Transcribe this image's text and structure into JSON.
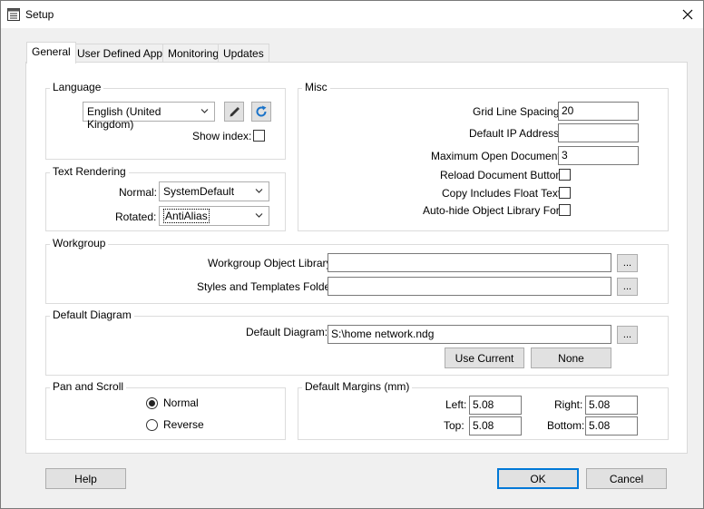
{
  "window": {
    "title": "Setup"
  },
  "tabs": [
    {
      "label": "General"
    },
    {
      "label": "User Defined Apps"
    },
    {
      "label": "Monitoring"
    },
    {
      "label": "Updates"
    }
  ],
  "language": {
    "group_title": "Language",
    "selected": "English (United Kingdom)",
    "show_index_label": "Show index:"
  },
  "text_rendering": {
    "group_title": "Text Rendering",
    "normal_label": "Normal:",
    "normal_value": "SystemDefault",
    "rotated_label": "Rotated:",
    "rotated_value": "AntiAlias"
  },
  "misc": {
    "group_title": "Misc",
    "grid_line_spacing_label": "Grid Line Spacing:",
    "grid_line_spacing_value": "20",
    "default_ip_label": "Default IP Address:",
    "default_ip_value": "",
    "max_open_docs_label": "Maximum Open Documents:",
    "max_open_docs_value": "3",
    "reload_doc_button_label": "Reload Document Button:",
    "copy_float_text_label": "Copy Includes Float Text:",
    "autohide_library_label": "Auto-hide Object Library Form:"
  },
  "workgroup": {
    "group_title": "Workgroup",
    "object_library_label": "Workgroup Object Library:",
    "object_library_value": "",
    "styles_folder_label": "Styles and Templates Folder:",
    "styles_folder_value": "",
    "browse_label": "..."
  },
  "default_diagram": {
    "group_title": "Default Diagram",
    "label": "Default Diagram:",
    "value": "S:\\home network.ndg",
    "use_current_label": "Use Current",
    "none_label": "None"
  },
  "pan_scroll": {
    "group_title": "Pan and Scroll",
    "normal_label": "Normal",
    "reverse_label": "Reverse"
  },
  "margins": {
    "group_title": "Default Margins (mm)",
    "left_label": "Left:",
    "left_value": "5.08",
    "right_label": "Right:",
    "right_value": "5.08",
    "top_label": "Top:",
    "top_value": "5.08",
    "bottom_label": "Bottom:",
    "bottom_value": "5.08"
  },
  "footer": {
    "help_label": "Help",
    "ok_label": "OK",
    "cancel_label": "Cancel"
  }
}
